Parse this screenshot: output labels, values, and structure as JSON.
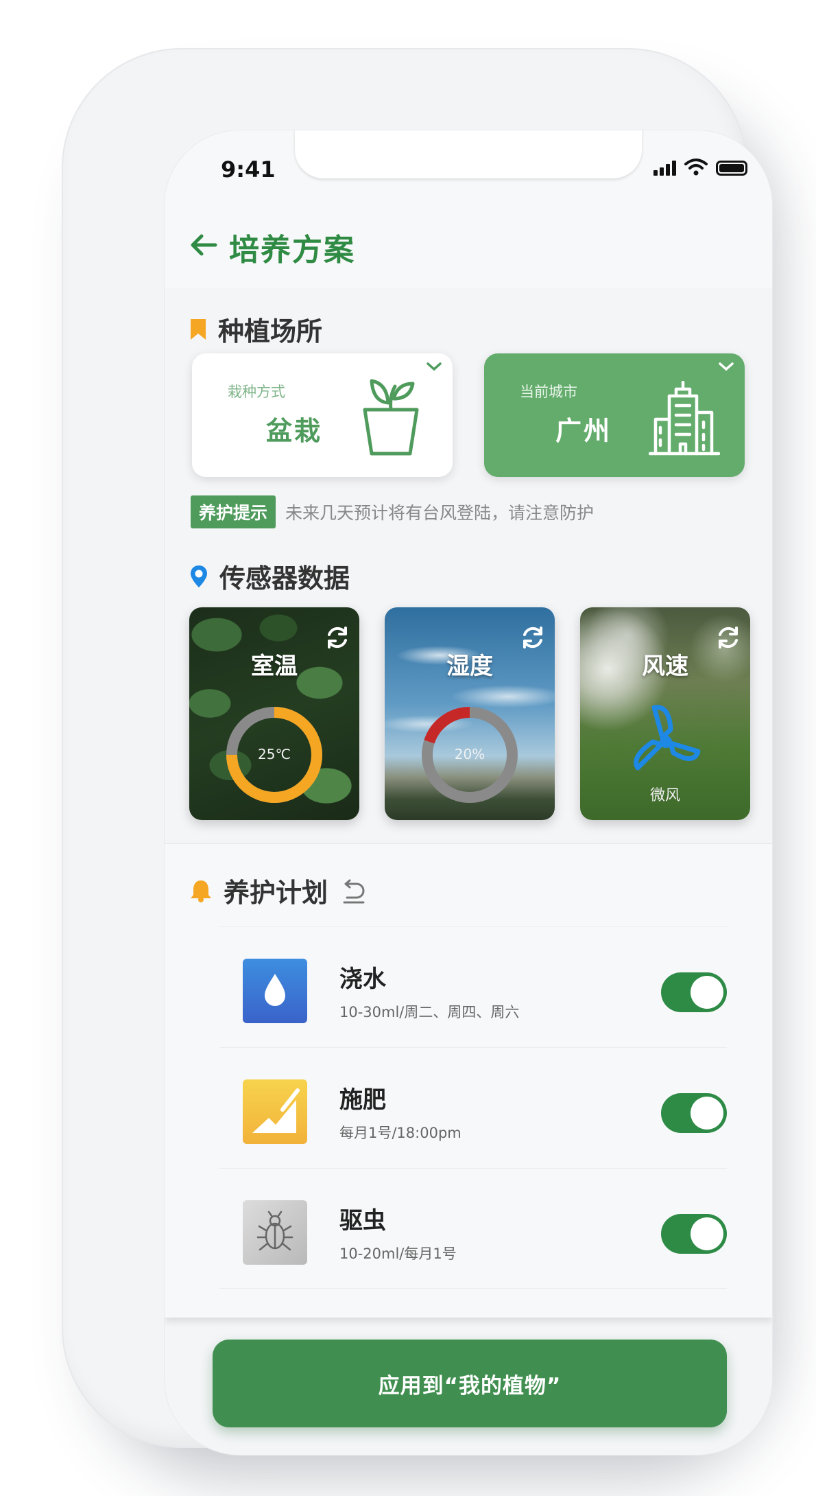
{
  "status": {
    "time": "9:41"
  },
  "nav": {
    "title": "培养方案",
    "back_icon": "arrow-left-icon"
  },
  "colors": {
    "primary": "#2f8b44",
    "card_green": "#63ac6c",
    "toggle_on": "#2d8b46",
    "temp_ring": "#f5a623",
    "humidity_ring": "#c62828",
    "fan": "#1e88e5"
  },
  "planting": {
    "title": "种植场所",
    "method": {
      "caption": "栽种方式",
      "value": "盆栽"
    },
    "city": {
      "caption": "当前城市",
      "value": "广州"
    }
  },
  "tip": {
    "badge": "养护提示",
    "text": "未来几天预计将有台风登陆，请注意防护"
  },
  "sensors": {
    "title": "传感器数据",
    "items": [
      {
        "title": "室温",
        "value": "25℃",
        "level": 0.75
      },
      {
        "title": "湿度",
        "value": "20%",
        "level": 0.2
      },
      {
        "title": "风速",
        "value": "微风"
      }
    ]
  },
  "plan": {
    "title": "养护计划",
    "items": [
      {
        "title": "浇水",
        "detail": "10-30ml/周二、周四、周六",
        "enabled": true,
        "icon": "water-drop-icon"
      },
      {
        "title": "施肥",
        "detail": "每月1号/18:00pm",
        "enabled": true,
        "icon": "fertilizer-icon"
      },
      {
        "title": "驱虫",
        "detail": "10-20ml/每月1号",
        "enabled": true,
        "icon": "bug-icon"
      }
    ]
  },
  "apply": {
    "label": "应用到“我的植物”"
  }
}
